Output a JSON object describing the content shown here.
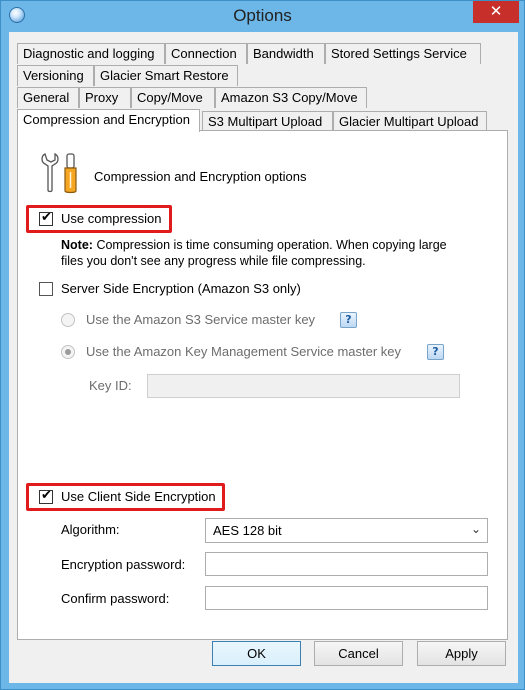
{
  "window": {
    "title": "Options",
    "close_label": "✕"
  },
  "tabs": {
    "row1": [
      "Diagnostic and logging",
      "Connection",
      "Bandwidth",
      "Stored Settings Service"
    ],
    "row2": [
      "Versioning",
      "Glacier Smart Restore"
    ],
    "row3": [
      "General",
      "Proxy",
      "Copy/Move",
      "Amazon S3 Copy/Move"
    ],
    "row4": [
      "Compression and Encryption",
      "S3 Multipart Upload",
      "Glacier Multipart Upload"
    ],
    "active": "Compression and Encryption"
  },
  "panel": {
    "section_title": "Compression and Encryption options",
    "use_compression": {
      "label": "Use compression",
      "checked": true
    },
    "note": {
      "label": "Note:",
      "text": "Compression is time consuming operation. When copying large files you don't see any progress while file compressing."
    },
    "server_side_encryption": {
      "label": "Server Side Encryption (Amazon S3 only)",
      "checked": false
    },
    "radio_s3_master_key": {
      "label": "Use the Amazon S3 Service master key",
      "selected": false
    },
    "radio_kms_master_key": {
      "label": "Use the Amazon Key Management Service master key",
      "selected": true
    },
    "key_id": {
      "label": "Key ID:",
      "value": ""
    },
    "use_client_side_encryption": {
      "label": "Use Client Side Encryption",
      "checked": true
    },
    "algorithm": {
      "label": "Algorithm:",
      "value": "AES 128 bit"
    },
    "encryption_password": {
      "label": "Encryption password:",
      "value": ""
    },
    "confirm_password": {
      "label": "Confirm password:",
      "value": ""
    },
    "help_glyph": "?"
  },
  "buttons": {
    "ok": "OK",
    "cancel": "Cancel",
    "apply": "Apply"
  },
  "colors": {
    "titlebar": "#6cb6e8",
    "close": "#c7302a",
    "highlight": "#e01b1b"
  }
}
